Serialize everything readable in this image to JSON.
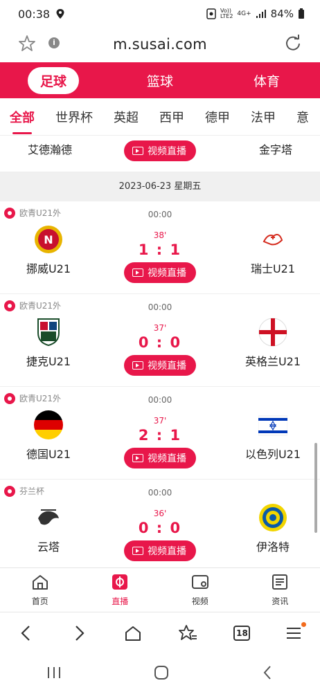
{
  "status": {
    "time": "00:38",
    "network": "LTE2",
    "network_top": "Vo))",
    "speed": "4G+",
    "battery": "84%"
  },
  "browser": {
    "url": "m.susai.com",
    "tab_count": "18"
  },
  "sport_tabs": [
    "足球",
    "篮球",
    "体育"
  ],
  "league_tabs": [
    "全部",
    "世界杯",
    "英超",
    "西甲",
    "德甲",
    "法甲",
    "意"
  ],
  "partial_match": {
    "home": "艾德瀚德",
    "away": "金字塔",
    "live_label": "视频直播"
  },
  "date": "2023-06-23   星期五",
  "matches": [
    {
      "league": "欧青U21外",
      "start": "00:00",
      "minute": "38'",
      "score": "1 : 1",
      "home": "挪威U21",
      "away": "瑞士U21",
      "live_label": "视频直播"
    },
    {
      "league": "欧青U21外",
      "start": "00:00",
      "minute": "37'",
      "score": "0 : 0",
      "home": "捷克U21",
      "away": "英格兰U21",
      "live_label": "视频直播"
    },
    {
      "league": "欧青U21外",
      "start": "00:00",
      "minute": "37'",
      "score": "2 : 1",
      "home": "德国U21",
      "away": "以色列U21",
      "live_label": "视频直播"
    },
    {
      "league": "芬兰杯",
      "start": "00:00",
      "minute": "36'",
      "score": "0 : 0",
      "home": "云塔",
      "away": "伊洛特",
      "live_label": "视频直播"
    }
  ],
  "bottom_nav": [
    "首页",
    "直播",
    "视频",
    "资讯"
  ],
  "colors": {
    "accent": "#e8174a"
  }
}
